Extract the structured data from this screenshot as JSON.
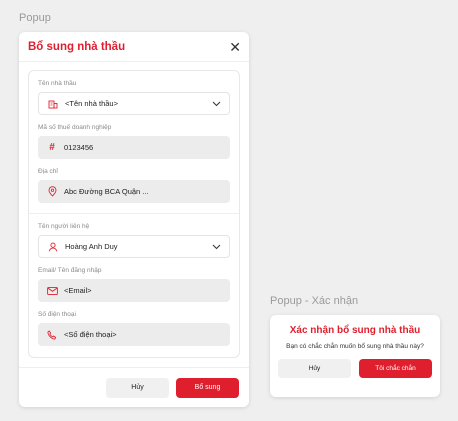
{
  "labels": {
    "popup": "Popup",
    "confirm_popup": "Popup - Xác nhận"
  },
  "main_dialog": {
    "title": "Bổ sung nhà thầu",
    "close_icon": "close-icon",
    "fields": [
      {
        "label": "Tên nhà thầu",
        "value": "<Tên nhà thầu>",
        "icon": "building-icon",
        "type": "select"
      },
      {
        "label": "Mã số thuế doanh nghiệp",
        "value": "0123456",
        "icon": "hash-icon",
        "type": "filled"
      },
      {
        "label": "Địa chỉ",
        "value": "Abc Đường BCA Quận ...",
        "icon": "location-pin-icon",
        "type": "filled"
      },
      {
        "label": "Tên người liên hệ",
        "value": "Hoàng Anh Duy",
        "icon": "user-icon",
        "type": "select"
      },
      {
        "label": "Email/ Tên đăng nhập",
        "value": "<Email>",
        "icon": "mail-icon",
        "type": "filled"
      },
      {
        "label": "Số điện thoại",
        "value": "<Số điện thoại>",
        "icon": "phone-icon",
        "type": "filled"
      }
    ],
    "cancel_label": "Hủy",
    "submit_label": "Bổ sung"
  },
  "confirm_dialog": {
    "title": "Xác nhận bổ sung nhà thầu",
    "message": "Bạn có chắc chắn muốn bổ sung nhà thầu này?",
    "cancel_label": "Hủy",
    "confirm_label": "Tôi chắc chắn"
  },
  "colors": {
    "accent": "#e01f2e",
    "field_bg": "#ececec",
    "page_bg": "#efefef"
  }
}
